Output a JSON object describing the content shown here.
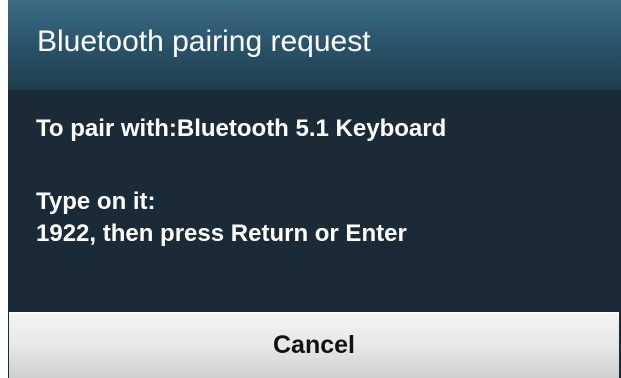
{
  "dialog": {
    "title": "Bluetooth pairing request",
    "pair_with_text": "To pair with:Bluetooth 5.1  Keyboard",
    "instruction_text": "Type on it:",
    "code_text": "1922, then press Return or Enter",
    "cancel_label": "Cancel"
  },
  "colors": {
    "titlebar": "#2b566c",
    "body": "#1b2a37",
    "text": "#ffffff",
    "button": "#e6e6e6"
  }
}
